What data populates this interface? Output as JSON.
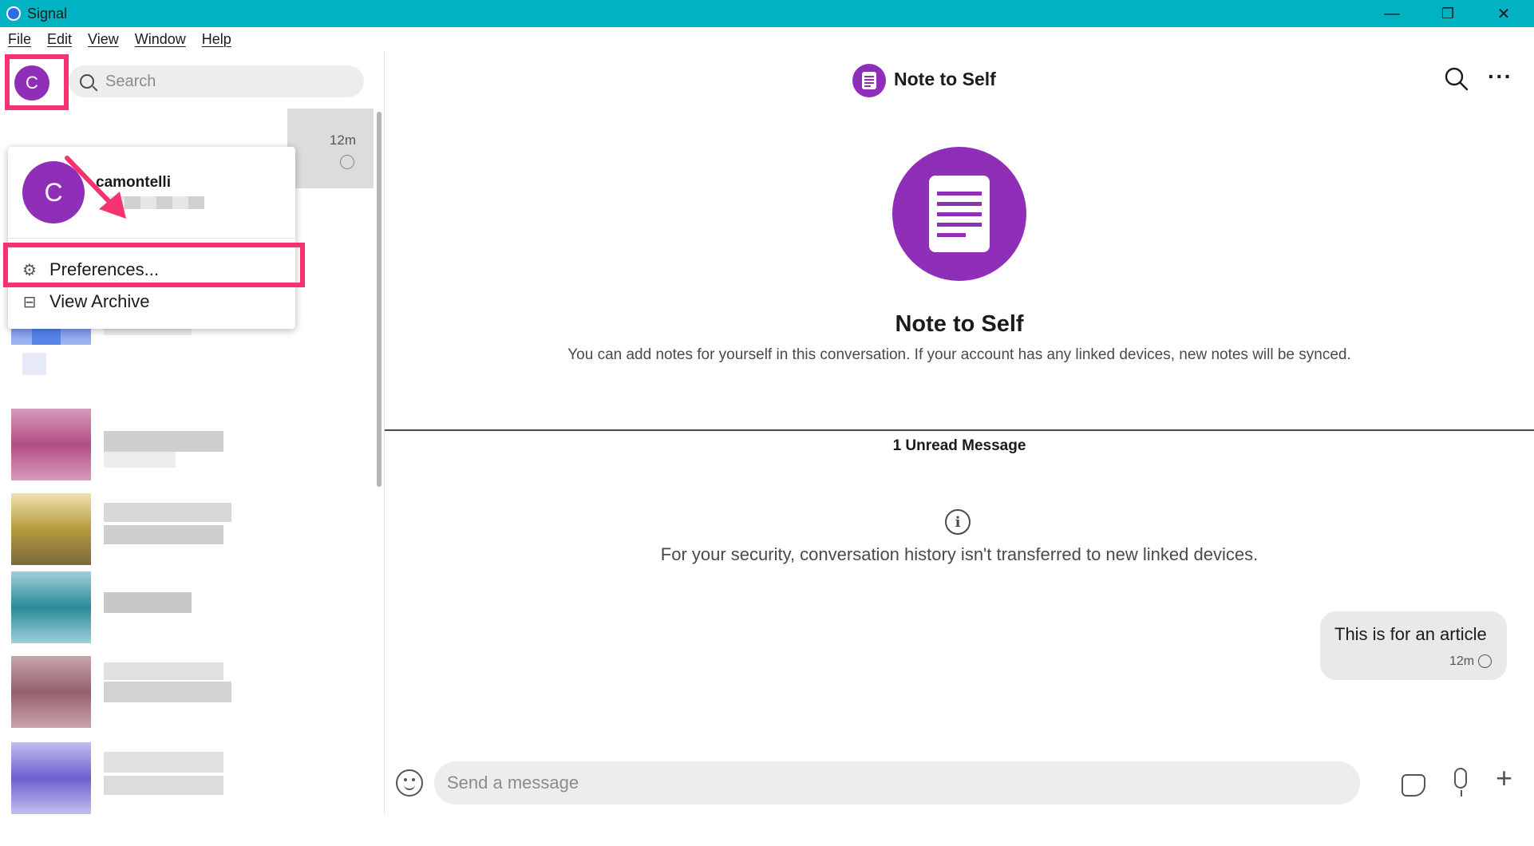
{
  "window": {
    "app_title": "Signal",
    "minimize": "—",
    "maximize": "❐",
    "close": "✕"
  },
  "menubar": [
    "File",
    "Edit",
    "View",
    "Window",
    "Help"
  ],
  "profile": {
    "avatar_letter": "C",
    "username": "camontelli"
  },
  "search": {
    "placeholder": "Search"
  },
  "conversation_list": {
    "first_item_time": "12m"
  },
  "profile_menu": {
    "preferences": "Preferences...",
    "view_archive": "View Archive"
  },
  "conversation": {
    "title": "Note to Self",
    "intro_title": "Note to Self",
    "intro_text": "You can add notes for yourself in this conversation. If your account has any linked devices, new notes will be synced.",
    "unread_label": "1 Unread Message",
    "security_notice": "For your security, conversation history isn't transferred to new linked devices.",
    "message": {
      "text": "This is for an article",
      "time": "12m"
    }
  },
  "composer": {
    "placeholder": "Send a message"
  },
  "colors": {
    "titlebar": "#00b2c2",
    "avatar": "#8f2fb8",
    "highlight": "#f5336f"
  }
}
